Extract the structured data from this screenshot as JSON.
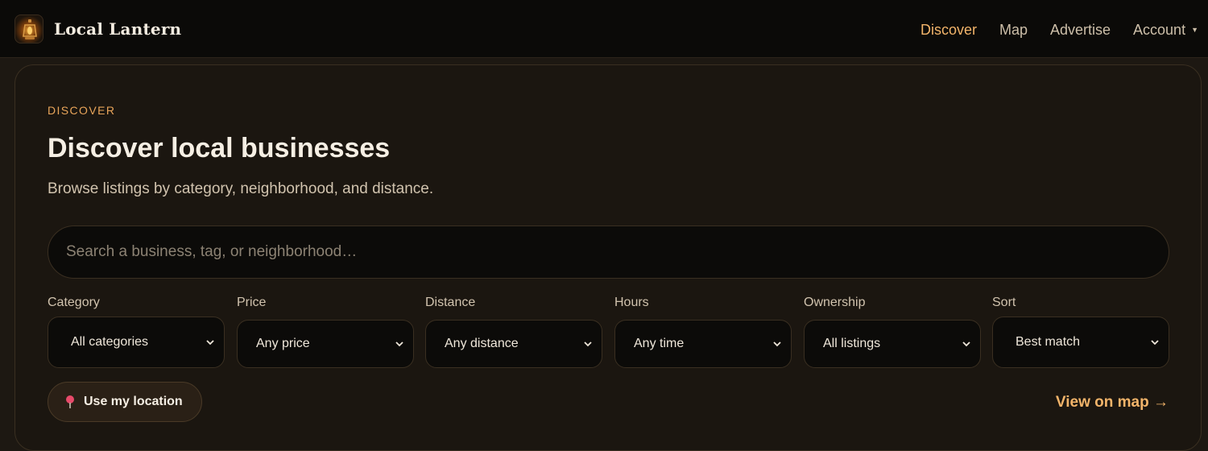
{
  "brand": {
    "name": "Local Lantern",
    "logo_icon": "lantern-icon"
  },
  "nav": {
    "items": [
      {
        "label": "Discover",
        "active": true
      },
      {
        "label": "Map",
        "active": false
      },
      {
        "label": "Advertise",
        "active": false
      }
    ],
    "account_label": "Account"
  },
  "hero": {
    "eyebrow": "DISCOVER",
    "title": "Discover local businesses",
    "subtitle": "Browse listings by category, neighborhood, and distance."
  },
  "search": {
    "placeholder": "Search a business, tag, or neighborhood…",
    "value": ""
  },
  "filters": [
    {
      "label": "Category",
      "selected": "All categories"
    },
    {
      "label": "Price",
      "selected": "Any price"
    },
    {
      "label": "Distance",
      "selected": "Any distance"
    },
    {
      "label": "Hours",
      "selected": "Any time"
    },
    {
      "label": "Ownership",
      "selected": "All listings"
    },
    {
      "label": "Sort",
      "selected": "Best match"
    }
  ],
  "actions": {
    "use_location": "Use my location",
    "view_map": "View on map →"
  },
  "colors": {
    "accent": "#f2b46a",
    "background": "#1d1812",
    "header": "#0b0a08",
    "input": "#0c0b09"
  }
}
